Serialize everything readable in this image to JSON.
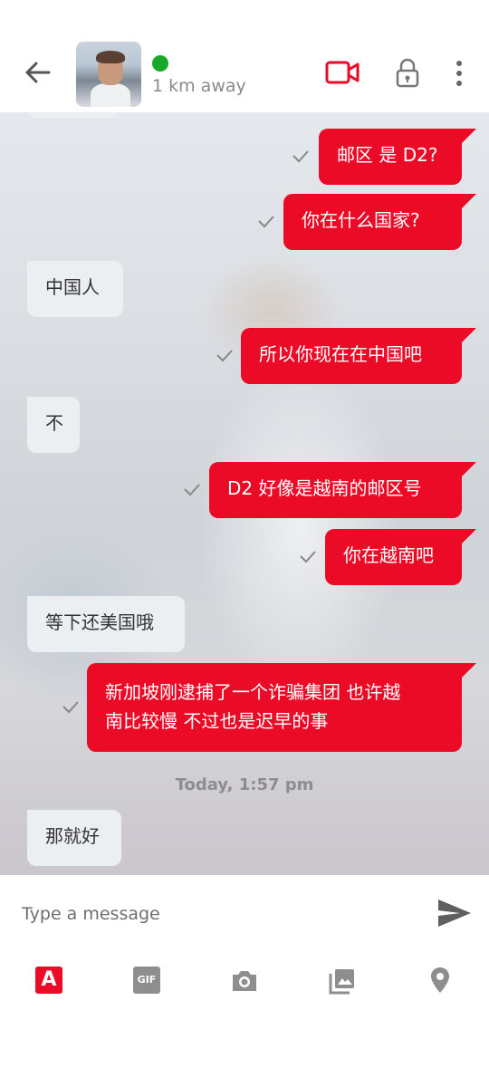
{
  "header": {
    "distance": "1 km away",
    "icons": [
      "back-arrow-icon",
      "video-call-icon",
      "lock-icon",
      "more-vertical-icon"
    ],
    "accent_color": "#ec0b27",
    "online_color": "#1aa82a"
  },
  "messages": [
    {
      "type": "out",
      "text": "邮区 是 D2?"
    },
    {
      "type": "out",
      "text": "你在什么国家?"
    },
    {
      "type": "in",
      "text": "中国人"
    },
    {
      "type": "out",
      "text": "所以你现在在中国吧"
    },
    {
      "type": "in",
      "text": "不"
    },
    {
      "type": "out",
      "text": "D2 好像是越南的邮区号"
    },
    {
      "type": "out",
      "text": "你在越南吧"
    },
    {
      "type": "in",
      "text": "等下还美国哦"
    },
    {
      "type": "out",
      "line1": "新加坡刚逮捕了一个诈骗集团 也许越",
      "line2": "南比较慢 不过也是迟早的事"
    },
    {
      "type": "in",
      "text": "那就好"
    }
  ],
  "date_divider": "Today, 1:57 pm",
  "composer": {
    "placeholder": "Type a message",
    "tools": [
      {
        "name": "text-style",
        "glyph": "A"
      },
      {
        "name": "gif",
        "glyph": "GIF"
      },
      {
        "name": "camera"
      },
      {
        "name": "gallery"
      },
      {
        "name": "location"
      }
    ]
  }
}
